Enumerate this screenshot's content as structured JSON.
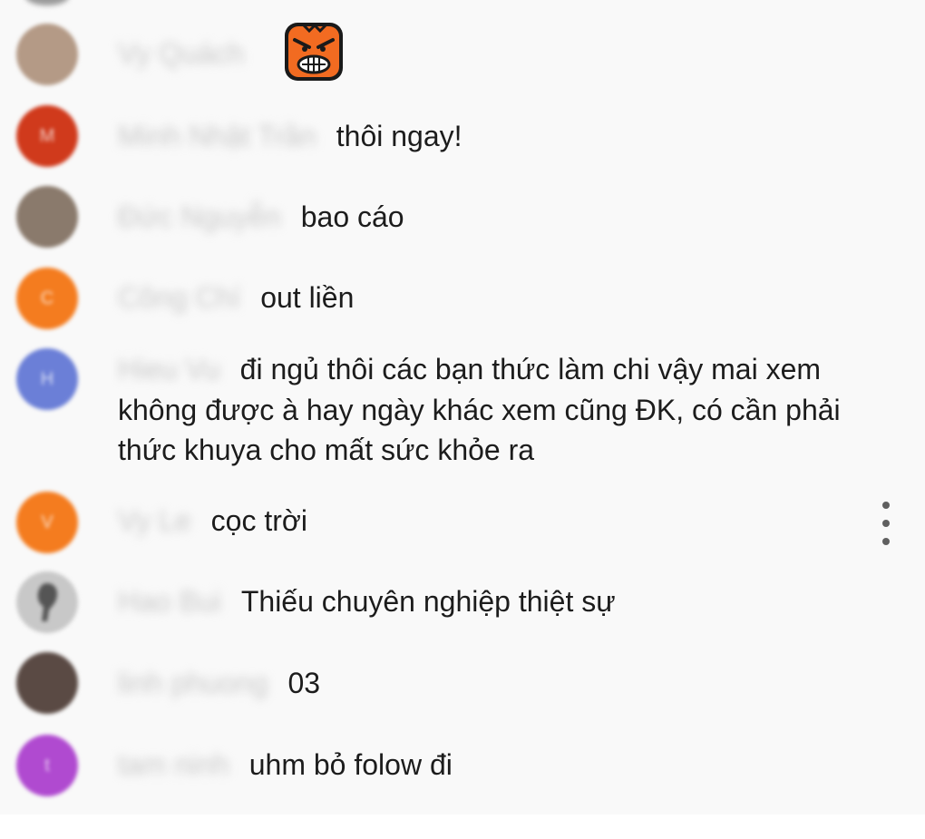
{
  "messages": [
    {
      "author": "Vy Quách",
      "text": "",
      "emote": "angry-face-emoji",
      "avatar": {
        "initial": "",
        "color": "#b49a86"
      }
    },
    {
      "author": "Minh Nhật Trần",
      "text": "thôi ngay!",
      "avatar": {
        "initial": "M",
        "color": "#d03a1c"
      }
    },
    {
      "author": "Đức Nguyễn",
      "text": "bao cáo",
      "avatar": {
        "initial": "",
        "color": "#8a7a6c"
      }
    },
    {
      "author": "Công Chí",
      "text": "out liền",
      "avatar": {
        "initial": "C",
        "color": "#f47c1f"
      }
    },
    {
      "author": "Hieu Vu",
      "text": "đi ngủ thôi các bạn thức làm chi vậy mai xem không được à hay ngày khác xem cũng ĐK, có cần phải thức khuya cho mất sức khỏe ra",
      "avatar": {
        "initial": "H",
        "color": "#6b7fd7"
      }
    },
    {
      "author": "Vy Le",
      "text": "cọc trời",
      "avatar": {
        "initial": "V",
        "color": "#f47c1f"
      }
    },
    {
      "author": "Hao Bui",
      "text": "Thiếu chuyên nghiệp thiệt sự",
      "avatar": {
        "initial": "",
        "color": "#c8c8c8"
      }
    },
    {
      "author": "linh phuong",
      "text": "03",
      "avatar": {
        "initial": "",
        "color": "#5a4a44"
      }
    },
    {
      "author": "tam ninh",
      "text": "uhm bỏ folow đi",
      "avatar": {
        "initial": "t",
        "color": "#b04ad0"
      }
    }
  ],
  "menu_icon": "more-vert-icon"
}
